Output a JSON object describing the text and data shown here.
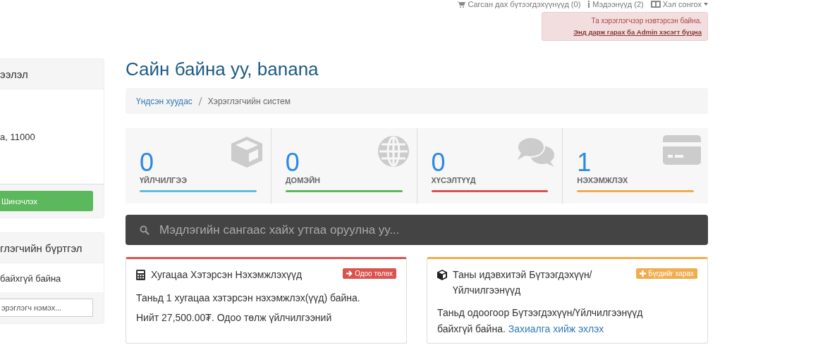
{
  "top_nav": [
    {
      "kind": "cart",
      "label": "Сагсан дах бүтээгдэхүүнүүд (0)"
    },
    {
      "kind": "info",
      "label": "Мэдээнүүд (2)"
    },
    {
      "kind": "language",
      "label": "Хэл сонгох"
    }
  ],
  "admin_notice": {
    "text": "Та хэрэглэгчээр нэвтэрсэн байна.",
    "link": "Энд дарж гарах ба Admin хэсэгт буцна"
  },
  "sidebar": {
    "info_panel": {
      "title": "ээлэл",
      "address": "а, 11000",
      "button": "Шинэчлэх"
    },
    "contacts_panel": {
      "title": "глэгчийн бүртгэл",
      "empty_text": "байхгүй байна",
      "placeholder": "эрэглэгч нэмэх..."
    }
  },
  "heading": "Сайн байна уу, banana",
  "breadcrumb": [
    {
      "label": "Үндсэн хуудас",
      "kind": "link"
    },
    {
      "label": "Хэрэглэгчийн систем",
      "kind": "current"
    }
  ],
  "stats": [
    {
      "kind": "box",
      "value": "0",
      "label": "ҮЙЛЧИЛГЭЭ",
      "color": "#5bc0de"
    },
    {
      "kind": "globe",
      "value": "0",
      "label": "ДОМЭЙН",
      "color": "#5cb85c"
    },
    {
      "kind": "chat",
      "value": "0",
      "label": "ХҮСЭЛТҮҮД",
      "color": "#d9534f"
    },
    {
      "kind": "card",
      "value": "1",
      "label": "НЭХЭМЖЛЭХ",
      "color": "#f0ad4e"
    }
  ],
  "search": {
    "placeholder": "Мэдлэгийн сангаас хайх утгаа оруулна уу..."
  },
  "cards": [
    {
      "kind": "invoices",
      "color": "#d9534f",
      "title": "Хугацаа Хэтэрсэн Нэхэмжлэхүүд",
      "button": "Одоо төлөх",
      "lines": [
        "Таньд 1 хугацаа хэтэрсэн нэхэмжлэх(үүд) байна.",
        "Нийт 27,500.00₮. Одоо төлж үйлчилгээний"
      ]
    },
    {
      "kind": "products",
      "color": "#f0ad4e",
      "title": "Таны идэвхитэй Бүтээгдэхүүн/ Үйлчилгээнүүд",
      "button": "Бүгдийг харах",
      "lines": [
        "Таньд одоогоор Бүтээгдэхүүн/Үйлчилгээнүүд"
      ],
      "last_line": "байхгүй байна.",
      "link": "Захиалга хийж эхлэх"
    }
  ]
}
